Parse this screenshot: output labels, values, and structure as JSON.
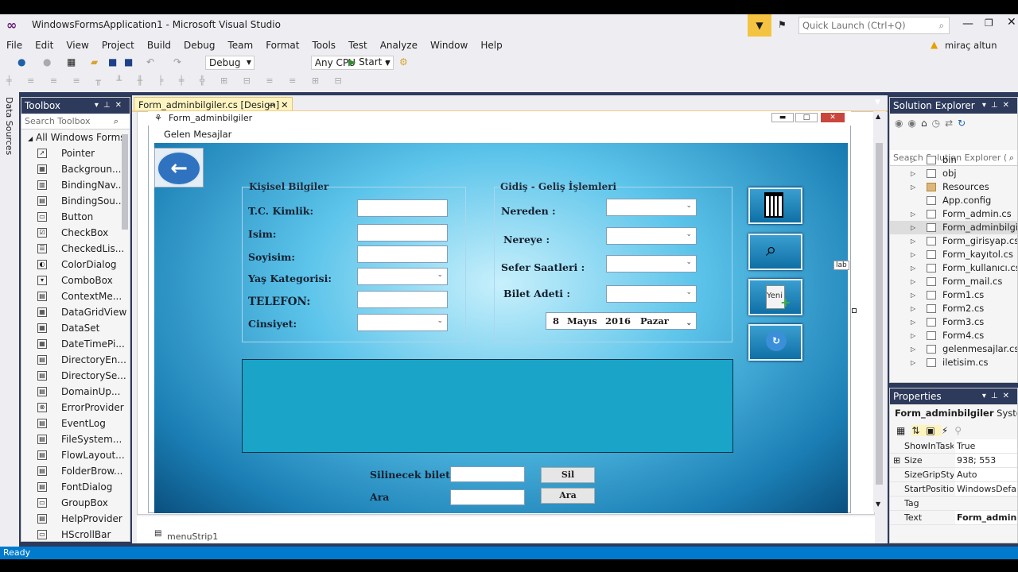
{
  "window": {
    "title": "WindowsFormsApplication1 - Microsoft Visual Studio",
    "quick_launch": "Quick Launch (Ctrl+Q)",
    "user": "miraç altun"
  },
  "menu": [
    "File",
    "Edit",
    "View",
    "Project",
    "Build",
    "Debug",
    "Team",
    "Format",
    "Tools",
    "Test",
    "Analyze",
    "Window",
    "Help"
  ],
  "toolbar": {
    "config": "Debug",
    "platform": "Any CPU",
    "start": "Start"
  },
  "left_strip": {
    "label": "Data Sources"
  },
  "toolbox": {
    "title": "Toolbox",
    "search_placeholder": "Search Toolbox",
    "group": "All Windows Forms",
    "items": [
      "Pointer",
      "Backgroun...",
      "BindingNav...",
      "BindingSou...",
      "Button",
      "CheckBox",
      "CheckedLis...",
      "ColorDialog",
      "ComboBox",
      "ContextMe...",
      "DataGridView",
      "DataSet",
      "DateTimePi...",
      "DirectoryEn...",
      "DirectorySe...",
      "DomainUp...",
      "ErrorProvider",
      "EventLog",
      "FileSystem...",
      "FlowLayout...",
      "FolderBrow...",
      "FontDialog",
      "GroupBox",
      "HelpProvider",
      "HScrollBar"
    ]
  },
  "doc_tab": {
    "label": "Form_adminbilgiler.cs [Design]"
  },
  "form": {
    "title": "Form_adminbilgiler",
    "menustrip_item": "Gelen Mesajlar",
    "group_personal": {
      "title": "Kişisel Bilgiler",
      "labels": [
        "T.C. Kimlik:",
        "Isim:",
        "Soyisim:",
        "Yaş Kategorisi:",
        "TELEFON:",
        "Cinsiyet:"
      ]
    },
    "group_trip": {
      "title": "Gidiş - Geliş İşlemleri",
      "labels": [
        "Nereden :",
        "Nereye :",
        "Sefer Saatleri :",
        "Bilet Adeti :"
      ],
      "date": {
        "day": "8",
        "month": "Mayıs",
        "year": "2016",
        "weekday": "Pazar"
      }
    },
    "side_buttons": {
      "new_label": "Yeni"
    },
    "delete_label": "Silinecek bilet",
    "search_label": "Ara",
    "delete_button": "Sil",
    "search_button": "Ara",
    "side_label": "lab"
  },
  "tray": {
    "label": "menuStrip1"
  },
  "solution_explorer": {
    "title": "Solution Explorer",
    "search_placeholder": "Search Solution Explorer (",
    "items": [
      "bin",
      "obj",
      "Resources",
      "App.config",
      "Form_admin.cs",
      "Form_adminbilgi",
      "Form_girisyap.cs",
      "Form_kayıtol.cs",
      "Form_kullanıcı.cs",
      "Form_mail.cs",
      "Form1.cs",
      "Form2.cs",
      "Form3.cs",
      "Form4.cs",
      "gelenmesajlar.cs",
      "iletisim.cs"
    ],
    "selected_index": 5
  },
  "properties": {
    "title": "Properties",
    "object": "Form_adminbilgiler",
    "object_type": "System.",
    "rows": [
      {
        "name": "ShowInTask",
        "value": "True"
      },
      {
        "name": "Size",
        "value": "938; 553"
      },
      {
        "name": "SizeGripStyl",
        "value": "Auto"
      },
      {
        "name": "StartPositio",
        "value": "WindowsDefa"
      },
      {
        "name": "Tag",
        "value": ""
      },
      {
        "name": "Text",
        "value": "Form_adminl"
      }
    ]
  },
  "status": {
    "text": "Ready"
  },
  "colors": {
    "accent": "#007acc",
    "form_bg": "#1b7fb5",
    "panel_dark": "#2d3a5c"
  }
}
